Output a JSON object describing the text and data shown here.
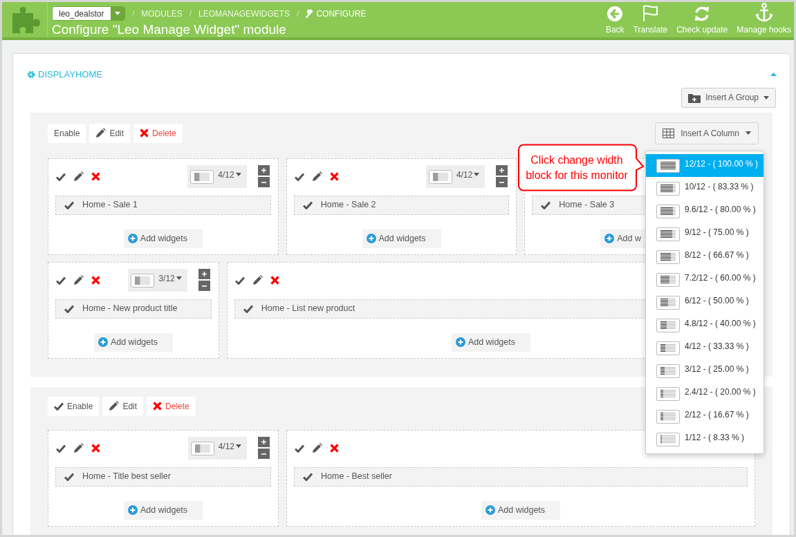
{
  "header": {
    "store_select": "leo_dealstor",
    "breadcrumb": [
      {
        "separator": "/",
        "label": "MODULES"
      },
      {
        "separator": "/",
        "label": "LEOMANAGEWIDGETS"
      },
      {
        "separator": "/",
        "label": "CONFIGURE"
      }
    ],
    "title": "Configure \"Leo Manage Widget\" module",
    "toolbar": [
      "Back",
      "Translate",
      "Check update",
      "Manage hooks"
    ]
  },
  "panel": {
    "title": "DISPLAYHOME",
    "expanded": true,
    "insert_group": "Insert A Group"
  },
  "groups": [
    {
      "actions": [
        {
          "kind": "enable",
          "label": "Enable"
        },
        {
          "kind": "edit",
          "label": "Edit"
        },
        {
          "kind": "delete",
          "label": "Delete"
        }
      ],
      "insert_column": "Insert A Column",
      "rows": [
        [
          {
            "kind": "span4",
            "size_label": "4/12",
            "widget": "Home - Sale 1",
            "add_label": "Add widgets"
          },
          {
            "kind": "span4",
            "size_label": "4/12",
            "widget": "Home - Sale 2",
            "add_label": "Add widgets"
          },
          {
            "kind": "span4",
            "tools_visible": false,
            "widget": "Home - Sale 3",
            "add_label": "Add w"
          }
        ],
        [
          {
            "kind": "span3",
            "size_label": "3/12",
            "widget": "Home - New product title",
            "add_label": "Add widgets"
          },
          {
            "kind": "span9",
            "widget": "Home - List new product",
            "add_label": "Add widgets"
          }
        ]
      ]
    },
    {
      "actions": [
        {
          "kind": "enable",
          "label": "Enable"
        },
        {
          "kind": "edit",
          "label": "Edit"
        },
        {
          "kind": "delete",
          "label": "Delete"
        }
      ],
      "rows": [
        [
          {
            "kind": "span4",
            "size_label": "4/12",
            "widget": "Home - Title best seller",
            "add_label": "Add widgets"
          },
          {
            "kind": "span8",
            "widget": "Home - Best seller",
            "add_label": "Add widgets"
          }
        ]
      ]
    }
  ],
  "width_menu": {
    "items": [
      {
        "label": "12/12 - ( 100.00 % )",
        "level": 1,
        "selected": true
      },
      {
        "label": "10/12 - ( 83.33 % )",
        "level": 0.8333,
        "selected": false
      },
      {
        "label": "9.6/12 - ( 80.00 % )",
        "level": 0.8,
        "selected": false
      },
      {
        "label": "9/12 - ( 75.00 % )",
        "level": 0.75,
        "selected": false
      },
      {
        "label": "8/12 - ( 66.67 % )",
        "level": 0.6667,
        "selected": false
      },
      {
        "label": "7.2/12 - ( 60.00 % )",
        "level": 0.6,
        "selected": false
      },
      {
        "label": "6/12 - ( 50.00 % )",
        "level": 0.5,
        "selected": false
      },
      {
        "label": "4.8/12 - ( 40.00 % )",
        "level": 0.4,
        "selected": false
      },
      {
        "label": "4/12 - ( 33.33 % )",
        "level": 0.3333,
        "selected": false
      },
      {
        "label": "3/12 - ( 25.00 % )",
        "level": 0.25,
        "selected": false
      },
      {
        "label": "2.4/12 - ( 20.00 % )",
        "level": 0.2,
        "selected": false
      },
      {
        "label": "2/12 - ( 16.67 % )",
        "level": 0.1667,
        "selected": false
      },
      {
        "label": "1/12 - ( 8.33 % )",
        "level": 0.0833,
        "selected": false
      }
    ]
  },
  "callout": "Click change width block for this monitor"
}
